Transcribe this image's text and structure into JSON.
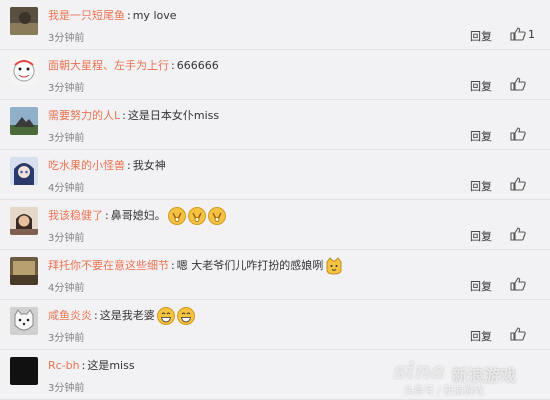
{
  "comments": [
    {
      "user": "我是一只短尾鱼",
      "text": "my love",
      "time": "3分钟前",
      "reply": "回复",
      "likes": "1",
      "emojis": []
    },
    {
      "user": "面朝大星程、左手为上行",
      "text": "666666",
      "time": "3分钟前",
      "reply": "回复",
      "likes": "",
      "emojis": []
    },
    {
      "user": "需要努力的人L",
      "text": "这是日本女仆miss",
      "time": "3分钟前",
      "reply": "回复",
      "likes": "",
      "emojis": []
    },
    {
      "user": "吃水果的小怪兽",
      "text": "我女神",
      "time": "4分钟前",
      "reply": "回复",
      "likes": "",
      "emojis": []
    },
    {
      "user": "我该稳健了",
      "text": "鼻哥媳妇。",
      "time": "3分钟前",
      "reply": "回复",
      "likes": "",
      "emojis": [
        "clap-emoji",
        "clap-emoji",
        "clap-emoji"
      ]
    },
    {
      "user": "拜托你不要在意这些细节",
      "text": "嗯 大老爷们儿咋打扮的感娘咧",
      "time": "4分钟前",
      "reply": "回复",
      "likes": "",
      "emojis": [
        "cat-emoji"
      ]
    },
    {
      "user": "咸鱼炎炎",
      "text": "这是我老婆",
      "time": "3分钟前",
      "reply": "回复",
      "likes": "",
      "emojis": [
        "grin-emoji",
        "grin-emoji"
      ]
    },
    {
      "user": "Rc-bh",
      "text": "这是miss",
      "time": "3分钟前",
      "reply": "",
      "likes": "",
      "emojis": []
    }
  ],
  "watermark": {
    "logo": "sina",
    "title": "新浪游戏",
    "subtitle": "头条号 / 新浪游戏"
  },
  "colors": {
    "username": "#eb7350",
    "time": "#808080",
    "background": "#f2f2f5"
  }
}
